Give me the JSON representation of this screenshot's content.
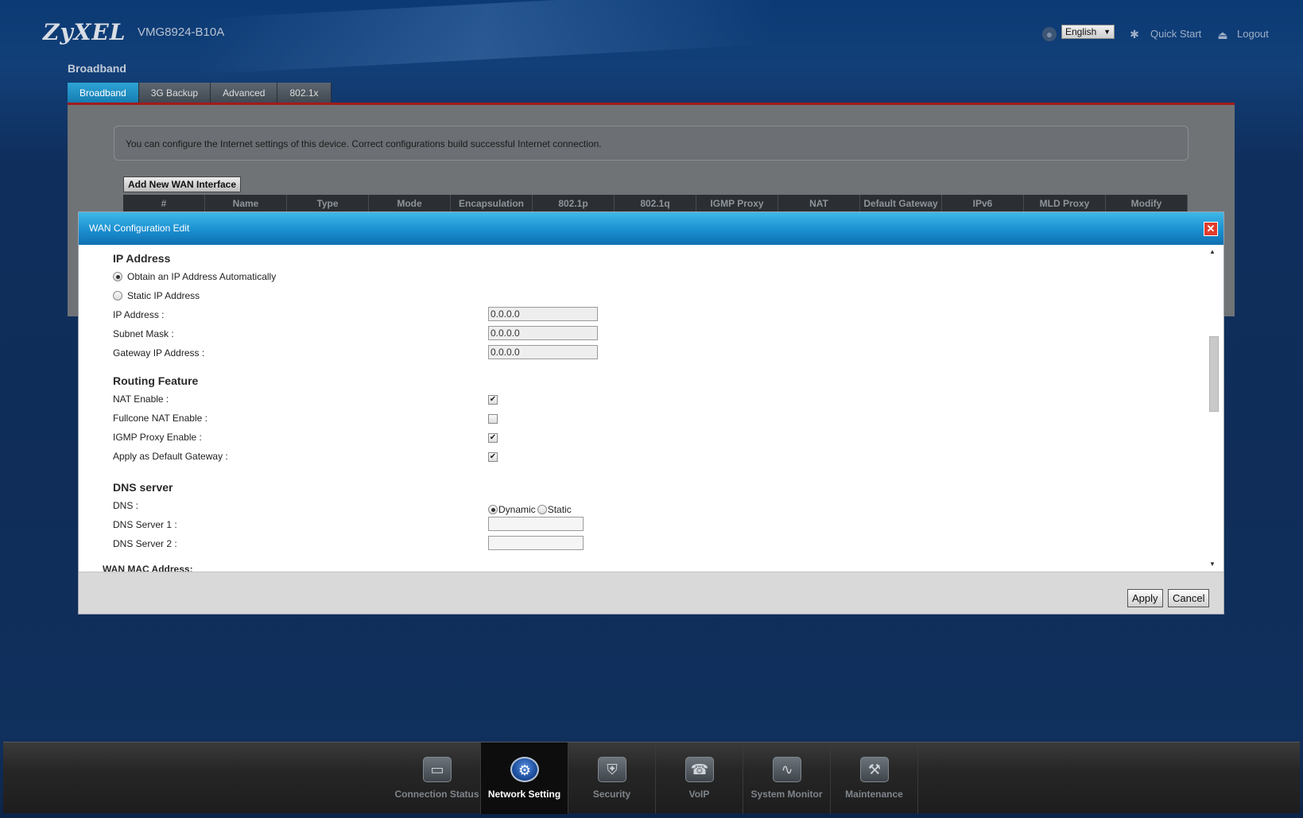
{
  "header": {
    "logo": "ZyXEL",
    "model": "VMG8924-B10A",
    "language": "English",
    "quick_start": "Quick Start",
    "logout": "Logout"
  },
  "page": {
    "title": "Broadband",
    "tabs": [
      {
        "label": "Broadband",
        "active": true
      },
      {
        "label": "3G Backup",
        "active": false
      },
      {
        "label": "Advanced",
        "active": false
      },
      {
        "label": "802.1x",
        "active": false
      }
    ],
    "info_text": "You can configure the Internet settings of this device. Correct configurations build successful Internet connection.",
    "add_wan_button": "Add New WAN Interface",
    "wan_columns": [
      "#",
      "Name",
      "Type",
      "Mode",
      "Encapsulation",
      "802.1p",
      "802.1q",
      "IGMP Proxy",
      "NAT",
      "Default Gateway",
      "IPv6",
      "MLD Proxy",
      "Modify"
    ]
  },
  "modal": {
    "title": "WAN Configuration Edit",
    "ip_section": {
      "title": "IP Address",
      "option_auto": "Obtain an IP Address Automatically",
      "option_static": "Static IP Address",
      "selected": "auto",
      "ip_label": "IP Address :",
      "ip_value": "0.0.0.0",
      "mask_label": "Subnet Mask :",
      "mask_value": "0.0.0.0",
      "gateway_label": "Gateway IP Address :",
      "gateway_value": "0.0.0.0"
    },
    "routing_section": {
      "title": "Routing Feature",
      "nat_label": "NAT Enable :",
      "nat_checked": true,
      "fullcone_label": "Fullcone NAT Enable :",
      "fullcone_checked": false,
      "igmp_label": "IGMP Proxy Enable :",
      "igmp_checked": true,
      "default_gw_label": "Apply as Default Gateway :",
      "default_gw_checked": true
    },
    "dns_section": {
      "title": "DNS server",
      "dns_label": "DNS :",
      "dynamic_label": "Dynamic",
      "static_label": "Static",
      "selected": "dynamic",
      "server1_label": "DNS Server 1 :",
      "server1_value": "",
      "server2_label": "DNS Server 2 :",
      "server2_value": ""
    },
    "cut_section_title": "WAN MAC Address:",
    "apply": "Apply",
    "cancel": "Cancel"
  },
  "bottom_nav": [
    {
      "label": "Connection Status",
      "icon": "connection-status-icon",
      "active": false
    },
    {
      "label": "Network Setting",
      "icon": "network-setting-icon",
      "active": true
    },
    {
      "label": "Security",
      "icon": "security-icon",
      "active": false
    },
    {
      "label": "VoIP",
      "icon": "voip-icon",
      "active": false
    },
    {
      "label": "System Monitor",
      "icon": "system-monitor-icon",
      "active": false
    },
    {
      "label": "Maintenance",
      "icon": "maintenance-icon",
      "active": false
    }
  ]
}
